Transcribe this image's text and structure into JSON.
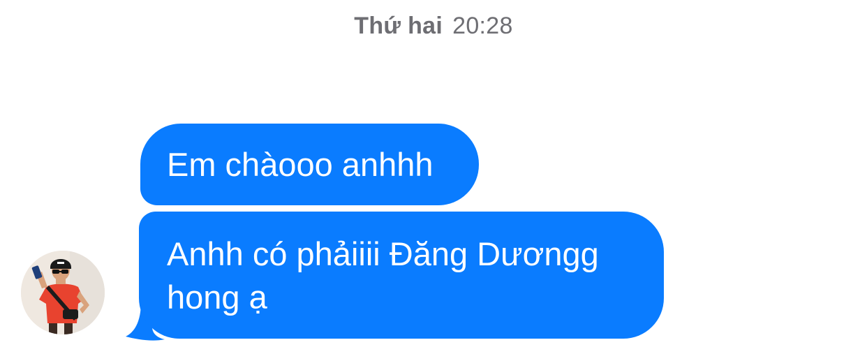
{
  "header": {
    "day": "Thứ hai",
    "time": "20:28"
  },
  "messages": [
    {
      "text": "Em chàooo anhhh"
    },
    {
      "text": "Anhh có phảiiii Đăng Dươngg hong ạ"
    }
  ],
  "colors": {
    "bubble": "#0a7cff",
    "bubble_text": "#ffffff",
    "timestamp": "#6e6e73",
    "background": "#ffffff"
  },
  "sender": {
    "avatar_icon": "user-avatar-photo"
  }
}
